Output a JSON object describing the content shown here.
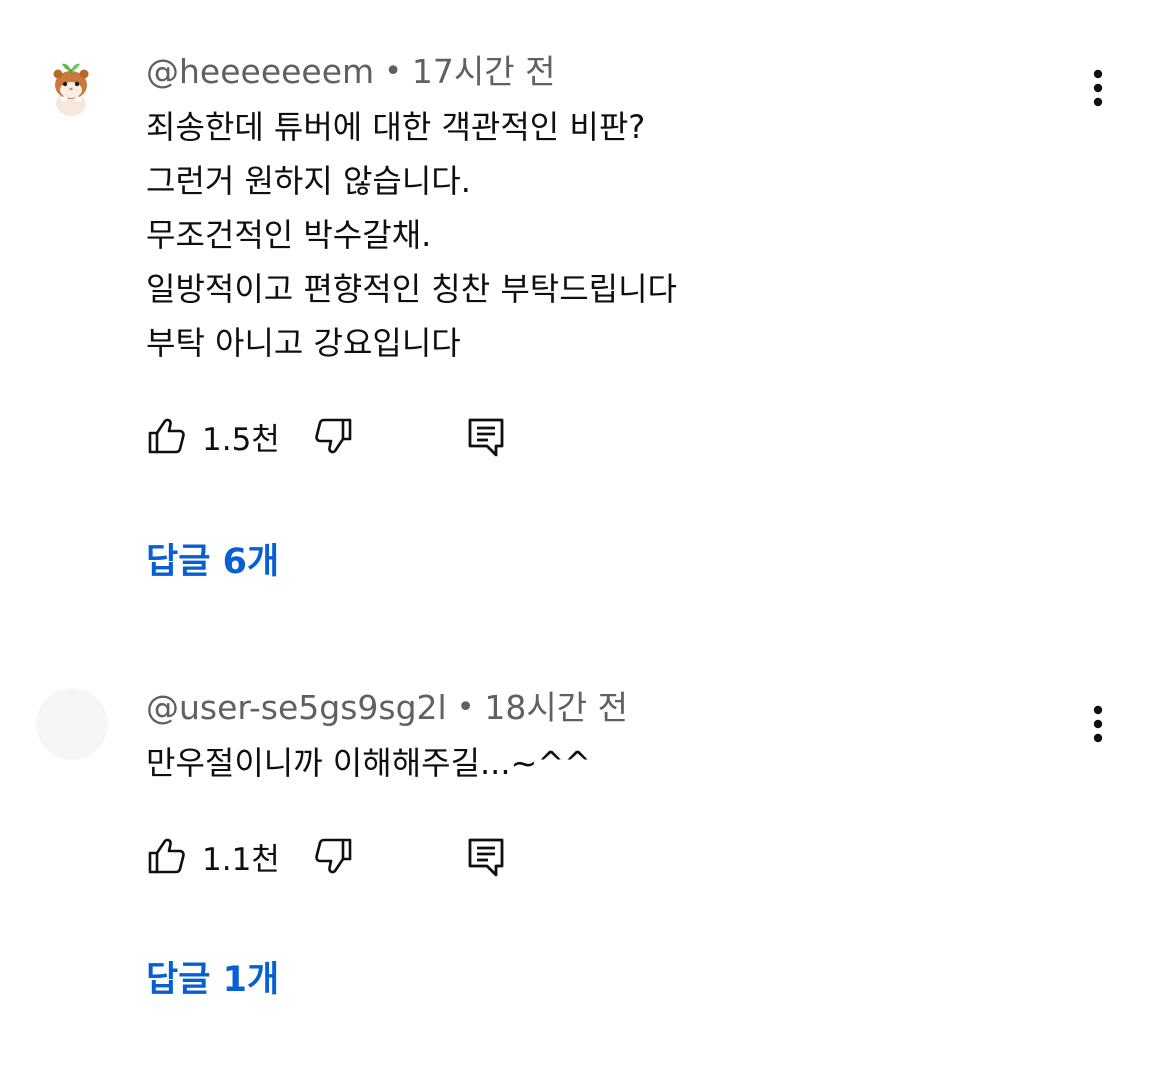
{
  "comments": [
    {
      "handle": "@heeeeeeem",
      "time": "17시간 전",
      "lines": [
        "죄송한데 튜버에 대한 객관적인 비판?",
        "그런거 원하지 않습니다.",
        "무조건적인 박수갈채.",
        "일방적이고 편향적인 칭찬 부탁드립니다",
        "부탁 아니고 강요입니다"
      ],
      "likes": "1.5천",
      "replies": "답글 6개",
      "avatar": "hamster-avatar"
    },
    {
      "handle": "@user-se5gs9sg2l",
      "time": "18시간 전",
      "lines": [
        "만우절이니까 이해해주길...~^^"
      ],
      "likes": "1.1천",
      "replies": "답글 1개",
      "avatar": "blank-avatar"
    }
  ],
  "separator": "•",
  "icons": {
    "like": "thumbs-up-icon",
    "dislike": "thumbs-down-icon",
    "reply": "comment-reply-icon",
    "more": "more-vert-icon"
  },
  "colors": {
    "link": "#065fd4",
    "meta": "#606060",
    "text": "#0f0f0f"
  }
}
